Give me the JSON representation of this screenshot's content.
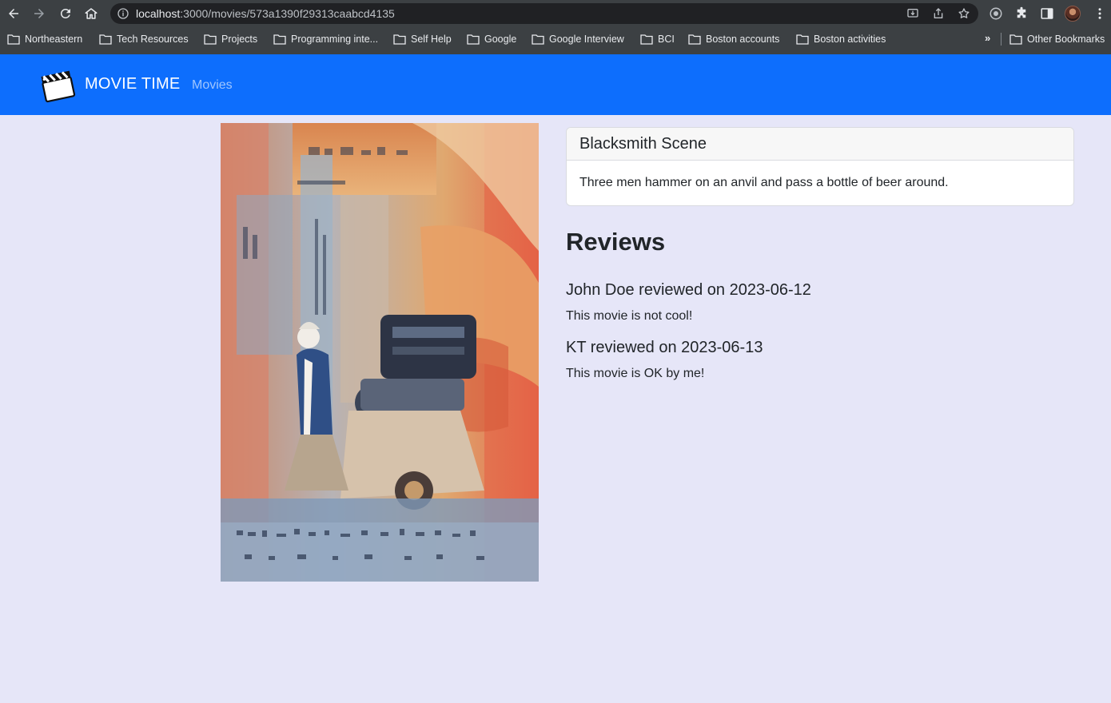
{
  "browser": {
    "url_host": "localhost",
    "url_path": ":3000/movies/573a1390f29313caabcd4135",
    "bookmarks": [
      "Northeastern",
      "Tech Resources",
      "Projects",
      "Programming inte...",
      "Self Help",
      "Google",
      "Google Interview",
      "BCI",
      "Boston accounts",
      "Boston activities"
    ],
    "overflow_label": "»",
    "other_bookmarks": "Other Bookmarks"
  },
  "navbar": {
    "brand": "MOVIE TIME",
    "links": [
      "Movies"
    ],
    "color": "#0d6efd"
  },
  "movie": {
    "title": "Blacksmith Scene",
    "plot": "Three men hammer on an anvil and pass a bottle of beer around."
  },
  "reviews": {
    "heading": "Reviews",
    "items": [
      {
        "header": "John Doe reviewed on 2023-06-12",
        "text": "This movie is not cool!"
      },
      {
        "header": "KT reviewed on 2023-06-13",
        "text": "This movie is OK by me!"
      }
    ]
  },
  "colors": {
    "page_background": "#e6e6f8",
    "chrome": "#3c4043"
  }
}
